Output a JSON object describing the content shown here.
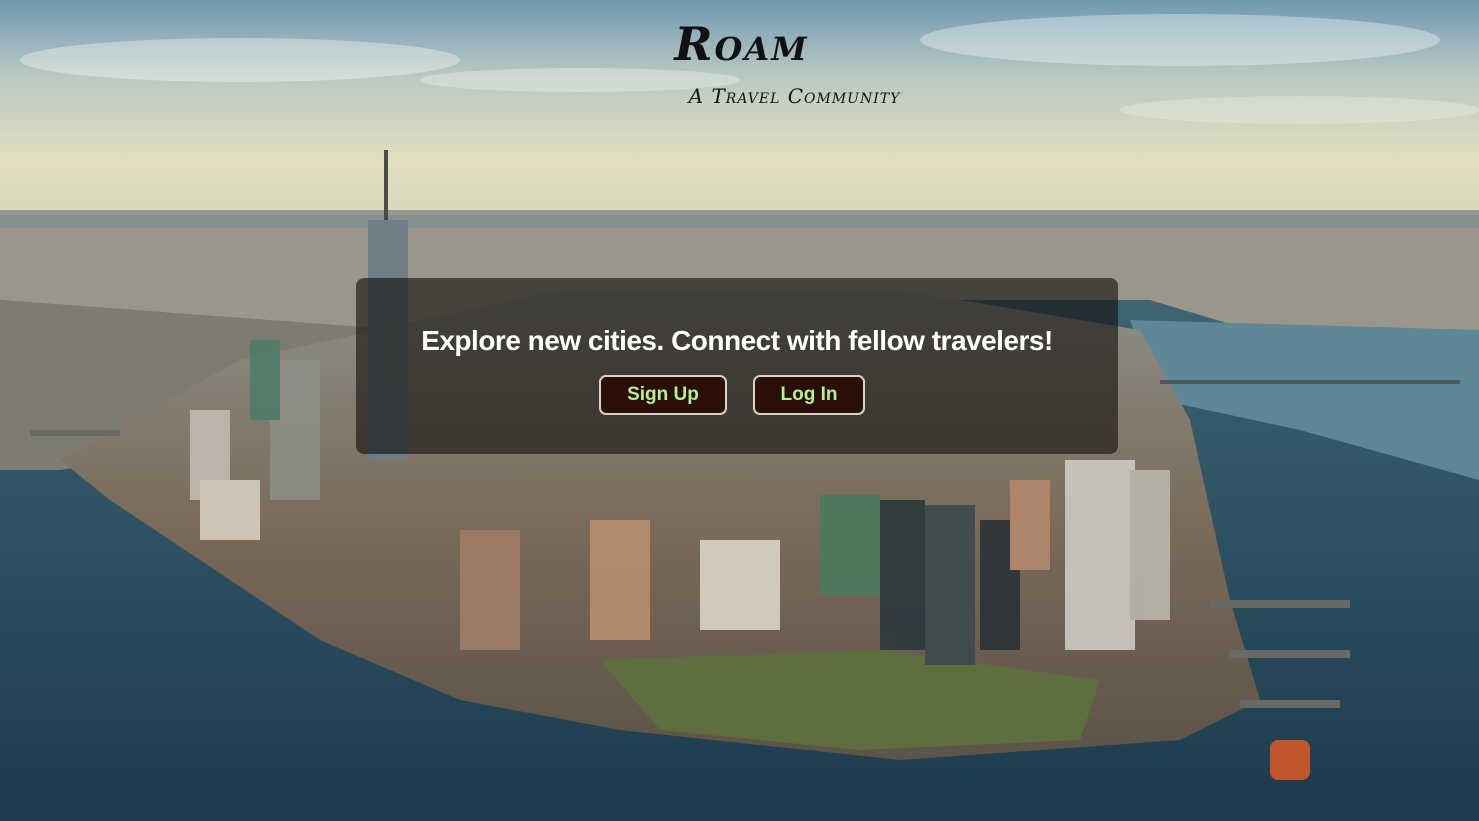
{
  "brand": {
    "title": "Roam",
    "tagline": "A Travel Community"
  },
  "hero": {
    "heading": "Explore new cities. Connect with fellow travelers!",
    "signup_label": "Sign Up",
    "login_label": "Log In"
  },
  "colors": {
    "button_background": "#2a0e08",
    "button_text": "#b6f08f",
    "button_border": "#d9d2c4",
    "overlay": "rgba(20,16,14,0.62)",
    "heading_text": "#ffffff"
  },
  "background": {
    "image": "aerial-city-skyline-photo"
  }
}
